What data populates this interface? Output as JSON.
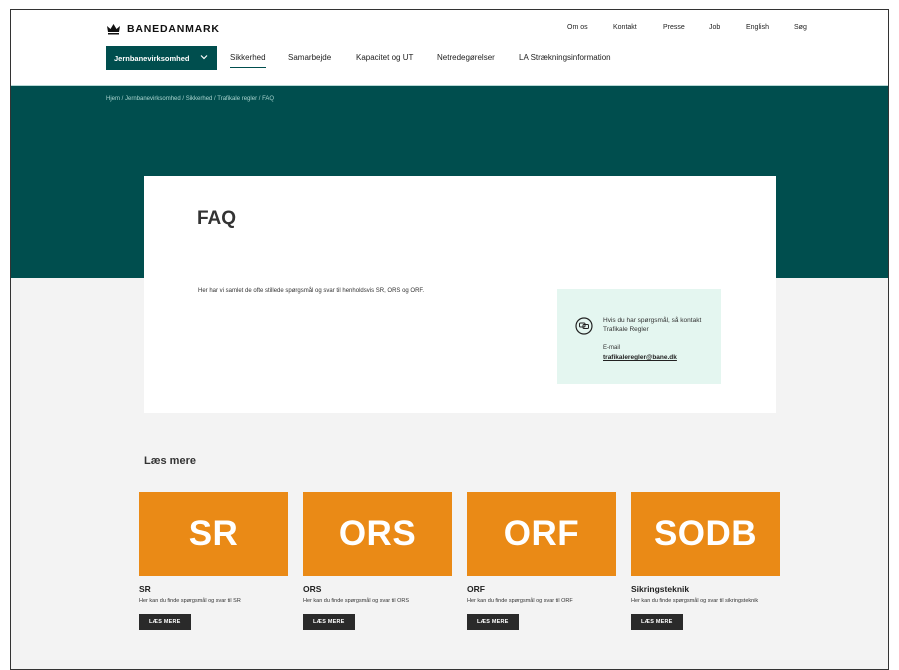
{
  "header": {
    "logo_text": "BANEDANMARK",
    "utility_nav": [
      "Om os",
      "Kontakt",
      "Presse",
      "Job",
      "English",
      "Søg"
    ],
    "dropdown_label": "Jernbanevirksomhed",
    "main_nav": [
      "Sikkerhed",
      "Samarbejde",
      "Kapacitet og UT",
      "Netredegørelser",
      "LA Strækningsinformation"
    ],
    "active_nav": "Sikkerhed"
  },
  "breadcrumb": "Hjem / Jernbanevirksomhed / Sikkerhed / Trafikale regler / FAQ",
  "card": {
    "title": "FAQ",
    "intro": "Her har vi samlet de ofte stillede spørgsmål og svar til henholdsvis SR, ORS og ORF.",
    "contact_text": "Hvis du har spørgsmål, så kontakt Trafikale Regler",
    "email_label": "E-mail",
    "email": "trafikaleregler@bane.dk"
  },
  "readmore": {
    "title": "Læs mere",
    "tiles": [
      {
        "image_text": "SR",
        "title": "SR",
        "desc": "Her kan du finde spørgsmål og svar til SR",
        "button": "LÆS MERE"
      },
      {
        "image_text": "ORS",
        "title": "ORS",
        "desc": "Her kan du finde spørgsmål og svar til ORS",
        "button": "LÆS MERE"
      },
      {
        "image_text": "ORF",
        "title": "ORF",
        "desc": "Her kan du finde spørgsmål og svar til ORF",
        "button": "LÆS MERE"
      },
      {
        "image_text": "SODB",
        "title": "Sikringsteknik",
        "desc": "Her kan du finde spørgsmål og svar til sikringsteknik",
        "button": "LÆS MERE"
      }
    ]
  },
  "colors": {
    "brand": "#004e4e",
    "accent": "#ea8a16",
    "contact_bg": "#e4f6f0"
  }
}
